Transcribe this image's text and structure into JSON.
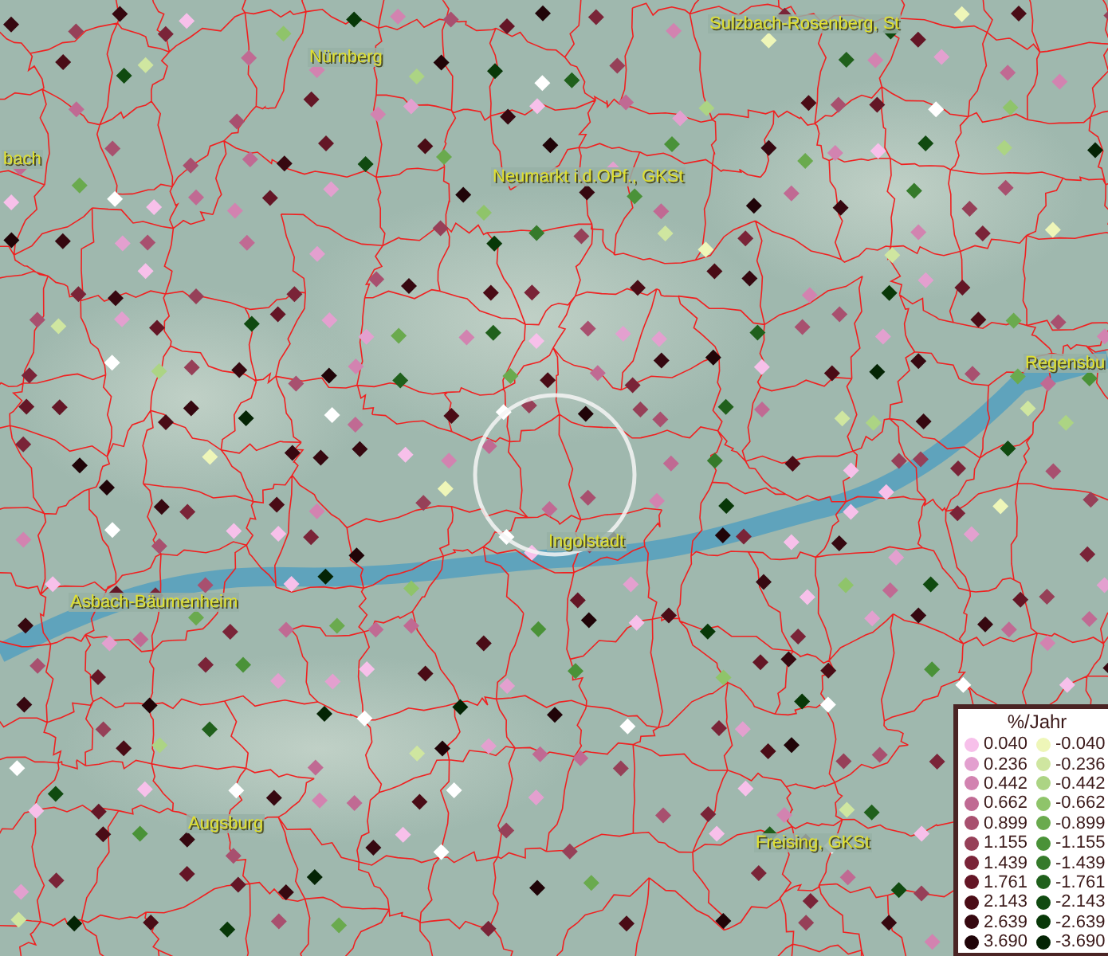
{
  "map": {
    "places": [
      {
        "name": "Sulzbach-Rosenberg, St"
      },
      {
        "name": "Nürnberg"
      },
      {
        "name": "bach"
      },
      {
        "name": "Neumarkt i.d.OPf., GKSt"
      },
      {
        "name": "Regensbu"
      },
      {
        "name": "Ingolstadt"
      },
      {
        "name": "Asbach-Bäumenheim"
      },
      {
        "name": "Augsburg"
      },
      {
        "name": "Freising, GKSt"
      }
    ]
  },
  "legend": {
    "title": "%/Jahr",
    "rows": [
      {
        "positive": {
          "value": "0.040",
          "color": "#f7c0ea"
        },
        "negative": {
          "value": "-0.040",
          "color": "#eef6b8"
        }
      },
      {
        "positive": {
          "value": "0.236",
          "color": "#e3a0cf"
        },
        "negative": {
          "value": "-0.236",
          "color": "#cfe6a0"
        }
      },
      {
        "positive": {
          "value": "0.442",
          "color": "#d283b0"
        },
        "negative": {
          "value": "-0.442",
          "color": "#acd484"
        }
      },
      {
        "positive": {
          "value": "0.662",
          "color": "#c06a93"
        },
        "negative": {
          "value": "-0.662",
          "color": "#8fc46a"
        }
      },
      {
        "positive": {
          "value": "0.899",
          "color": "#a8506f"
        },
        "negative": {
          "value": "-0.899",
          "color": "#6aaa4e"
        }
      },
      {
        "positive": {
          "value": "1.155",
          "color": "#964058"
        },
        "negative": {
          "value": "-1.155",
          "color": "#4a9238"
        }
      },
      {
        "positive": {
          "value": "1.439",
          "color": "#7a2438"
        },
        "negative": {
          "value": "-1.439",
          "color": "#357a2a"
        }
      },
      {
        "positive": {
          "value": "1.761",
          "color": "#641626"
        },
        "negative": {
          "value": "-1.761",
          "color": "#20601c"
        }
      },
      {
        "positive": {
          "value": "2.143",
          "color": "#4a0c16"
        },
        "negative": {
          "value": "-2.143",
          "color": "#104a10"
        }
      },
      {
        "positive": {
          "value": "2.639",
          "color": "#360810"
        },
        "negative": {
          "value": "-2.639",
          "color": "#083808"
        }
      },
      {
        "positive": {
          "value": "3.690",
          "color": "#200408"
        },
        "negative": {
          "value": "-3.690",
          "color": "#042404"
        }
      }
    ]
  }
}
